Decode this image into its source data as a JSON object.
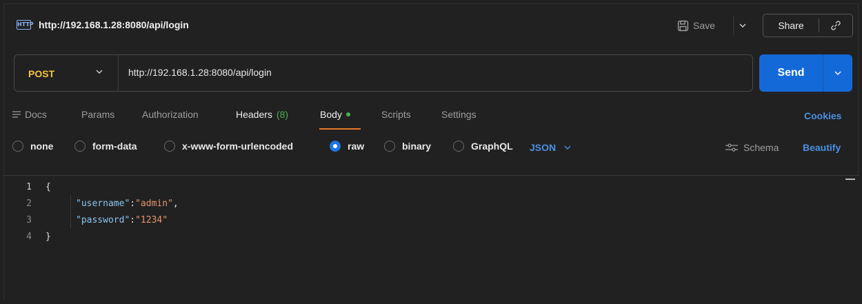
{
  "window": {
    "request_title": "http://192.168.1.28:8080/api/login",
    "http_icon_label": "HTTP",
    "save_label": "Save",
    "share_label": "Share"
  },
  "request": {
    "method": "POST",
    "url": "http://192.168.1.28:8080/api/login",
    "send_label": "Send"
  },
  "tabs": {
    "docs": "Docs",
    "params": "Params",
    "authorization": "Authorization",
    "headers": "Headers",
    "headers_count": "(8)",
    "body": "Body",
    "scripts": "Scripts",
    "settings": "Settings",
    "cookies": "Cookies"
  },
  "body_types": {
    "none": "none",
    "form_data": "form-data",
    "urlencoded": "x-www-form-urlencoded",
    "raw": "raw",
    "binary": "binary",
    "graphql": "GraphQL",
    "selected": "raw",
    "language": "JSON",
    "schema_label": "Schema",
    "beautify_label": "Beautify"
  },
  "editor": {
    "line_numbers": [
      "1",
      "2",
      "3",
      "4"
    ],
    "open_brace": "{",
    "close_brace": "}",
    "entries": [
      {
        "key": "\"username\"",
        "value": "\"admin\"",
        "trail": ","
      },
      {
        "key": "\"password\"",
        "value": "\"1234\"",
        "trail": ""
      }
    ]
  },
  "colors": {
    "accent_blue": "#1469d9",
    "method_yellow": "#f5c542",
    "active_tab_underline": "#e8792a",
    "json_key": "#8ac6f2",
    "json_string": "#e8956a"
  }
}
